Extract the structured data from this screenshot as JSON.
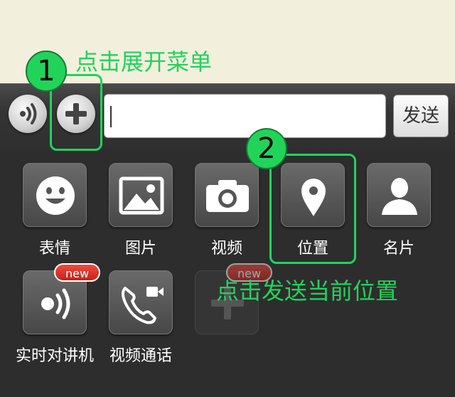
{
  "input_bar": {
    "send_label": "发送",
    "voice_icon": "voice-wave-icon",
    "add_icon": "plus-icon"
  },
  "panel_items": [
    {
      "label": "表情",
      "icon": "smiley-icon"
    },
    {
      "label": "图片",
      "icon": "image-icon"
    },
    {
      "label": "视频",
      "icon": "camera-icon"
    },
    {
      "label": "位置",
      "icon": "location-pin-icon"
    },
    {
      "label": "名片",
      "icon": "contact-card-icon"
    },
    {
      "label": "实时对讲机",
      "icon": "walkie-talkie-icon",
      "badge": "new"
    },
    {
      "label": "视频通话",
      "icon": "video-call-icon"
    },
    {
      "label": "",
      "icon": "plus-icon",
      "badge": "new"
    }
  ],
  "annotations": {
    "step1_number": "1",
    "step1_text": "点击展开菜单",
    "step2_number": "2",
    "step2_text": "点击发送当前位置",
    "highlight_color": "#22d35a"
  }
}
